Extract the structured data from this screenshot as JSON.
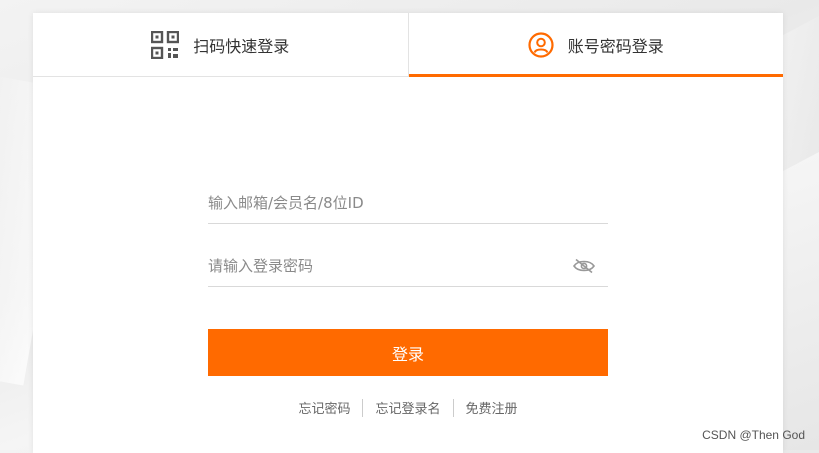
{
  "tabs": {
    "qr_label": "扫码快速登录",
    "account_label": "账号密码登录"
  },
  "form": {
    "username_placeholder": "输入邮箱/会员名/8位ID",
    "password_placeholder": "请输入登录密码",
    "login_label": "登录"
  },
  "links": {
    "forgot_password": "忘记密码",
    "forgot_username": "忘记登录名",
    "register": "免费注册"
  },
  "watermark": "CSDN @Then God",
  "colors": {
    "accent": "#ff6a00",
    "qr_icon": "#555555"
  },
  "icons": {
    "qr": "qr-code-icon",
    "user": "user-circle-icon",
    "eye": "eye-off-icon"
  }
}
